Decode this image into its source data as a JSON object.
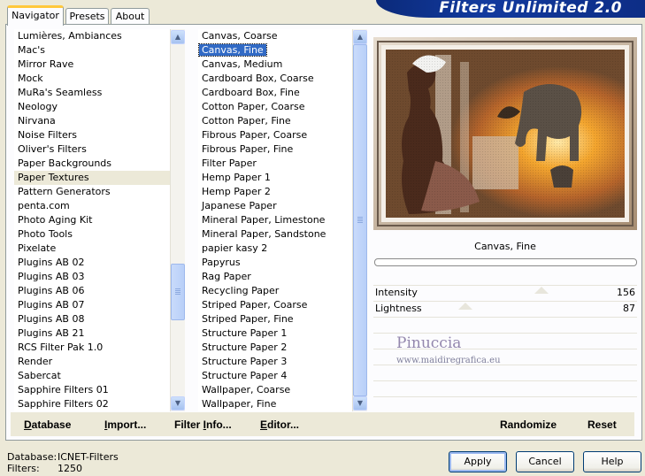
{
  "tabs": [
    "Navigator",
    "Presets",
    "About"
  ],
  "banner_title": "Filters Unlimited 2.0",
  "categories": {
    "items": [
      "Lumières, Ambiances",
      "Mac's",
      "Mirror Rave",
      "Mock",
      "MuRa's Seamless",
      "Neology",
      "Nirvana",
      "Noise Filters",
      "Oliver's Filters",
      "Paper Backgrounds",
      "Paper Textures",
      "Pattern Generators",
      "penta.com",
      "Photo Aging Kit",
      "Photo Tools",
      "Pixelate",
      "Plugins AB 02",
      "Plugins AB 03",
      "Plugins AB 06",
      "Plugins AB 07",
      "Plugins AB 08",
      "Plugins AB 21",
      "RCS Filter Pak 1.0",
      "Render",
      "Sabercat",
      "Sapphire Filters 01",
      "Sapphire Filters 02"
    ],
    "highlighted": "Paper Textures"
  },
  "filters": {
    "items": [
      "Canvas, Coarse",
      "Canvas, Fine",
      "Canvas, Medium",
      "Cardboard Box, Coarse",
      "Cardboard Box, Fine",
      "Cotton Paper, Coarse",
      "Cotton Paper, Fine",
      "Fibrous Paper, Coarse",
      "Fibrous Paper, Fine",
      "Filter Paper",
      "Hemp Paper 1",
      "Hemp Paper 2",
      "Japanese Paper",
      "Mineral Paper, Limestone",
      "Mineral Paper, Sandstone",
      "papier kasy 2",
      "Papyrus",
      "Rag Paper",
      "Recycling Paper",
      "Striped Paper, Coarse",
      "Striped Paper, Fine",
      "Structure Paper 1",
      "Structure Paper 2",
      "Structure Paper 3",
      "Structure Paper 4",
      "Wallpaper, Coarse",
      "Wallpaper, Fine"
    ],
    "selected": "Canvas, Fine"
  },
  "toolbar": {
    "database": {
      "u": "D",
      "rest": "atabase"
    },
    "import": {
      "u": "I",
      "rest": "mport..."
    },
    "filter_info": {
      "pre": "Filter ",
      "u": "I",
      "rest": "nfo..."
    },
    "editor": {
      "u": "E",
      "rest": "ditor..."
    },
    "randomize": "Randomize",
    "reset": "Reset"
  },
  "preview": {
    "filter_name": "Canvas, Fine",
    "watermark_name": "Pinuccia",
    "watermark_url": "www.maidiregrafica.eu"
  },
  "params": [
    {
      "label": "Intensity",
      "value": "156"
    },
    {
      "label": "Lightness",
      "value": "87"
    }
  ],
  "footer": {
    "database_label": "Database:",
    "database_value": "ICNET-Filters",
    "filters_label": "Filters:",
    "filters_value": "1250",
    "apply": "Apply",
    "cancel": "Cancel",
    "help": "Help"
  },
  "colors": {
    "banner": "#123a9e",
    "selection": "#316ac5",
    "tab_accent": "#ffc83c",
    "dialog_bg": "#ece9d8"
  }
}
